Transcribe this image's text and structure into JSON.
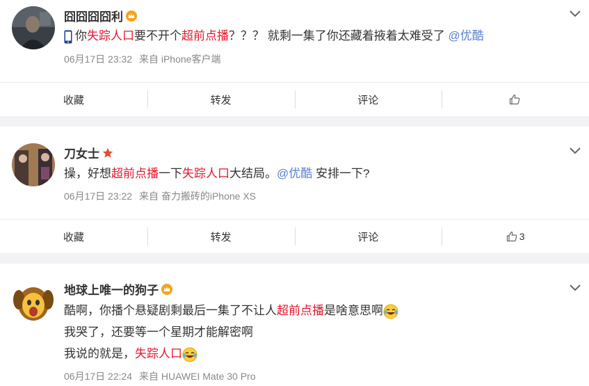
{
  "actions": {
    "favorite": "收藏",
    "repost": "转发",
    "comment": "评论"
  },
  "icons": {
    "chevron": "chevron-down-icon",
    "like": "thumbs-up-icon",
    "badge_crown": "crown-badge-icon",
    "badge_star": "star-badge-icon",
    "emoji_laugh_cry": "laugh-cry-emoji-icon",
    "phone": "phone-emoji-icon"
  },
  "colors": {
    "highlight": "#e6162d",
    "mention": "#5b7fd1",
    "meta": "#888888",
    "page_bg": "#f2f2f5"
  },
  "posts": [
    {
      "username": "囧囧囧囧利",
      "content": {
        "p1": "你",
        "k1": "失踪人口",
        "p2": "要不开个",
        "k2": "超前点播",
        "p3": "？？？ 就剩一集了你还藏着掖着太难受了 ",
        "mention": "@优酷"
      },
      "meta": {
        "date": "06月17日 23:32",
        "source": "来自 iPhone客户端"
      },
      "likes": ""
    },
    {
      "username": "刀女士",
      "content": {
        "p1": "操，好想",
        "k1": "超前点播",
        "p2": "一下",
        "k2": "失踪人口",
        "p3": "大结局。",
        "mention": "@优酷",
        "p4": " 安排一下?"
      },
      "meta": {
        "date": "06月17日 23:22",
        "source": "来自 奋力搬砖的iPhone XS"
      },
      "likes": "3"
    },
    {
      "username": "地球上唯一的狗子",
      "content": {
        "line1_p1": "酷啊，你播个悬疑剧剩最后一集了不让人",
        "line1_k1": "超前点播",
        "line1_p2": "是啥意思啊",
        "line2": "我哭了，还要等一个星期才能解密啊",
        "line3_p1": "我说的就是，",
        "line3_k1": "失踪人口"
      },
      "meta": {
        "date": "06月17日 22:24",
        "source": "来自 HUAWEI Mate 30 Pro"
      }
    }
  ]
}
